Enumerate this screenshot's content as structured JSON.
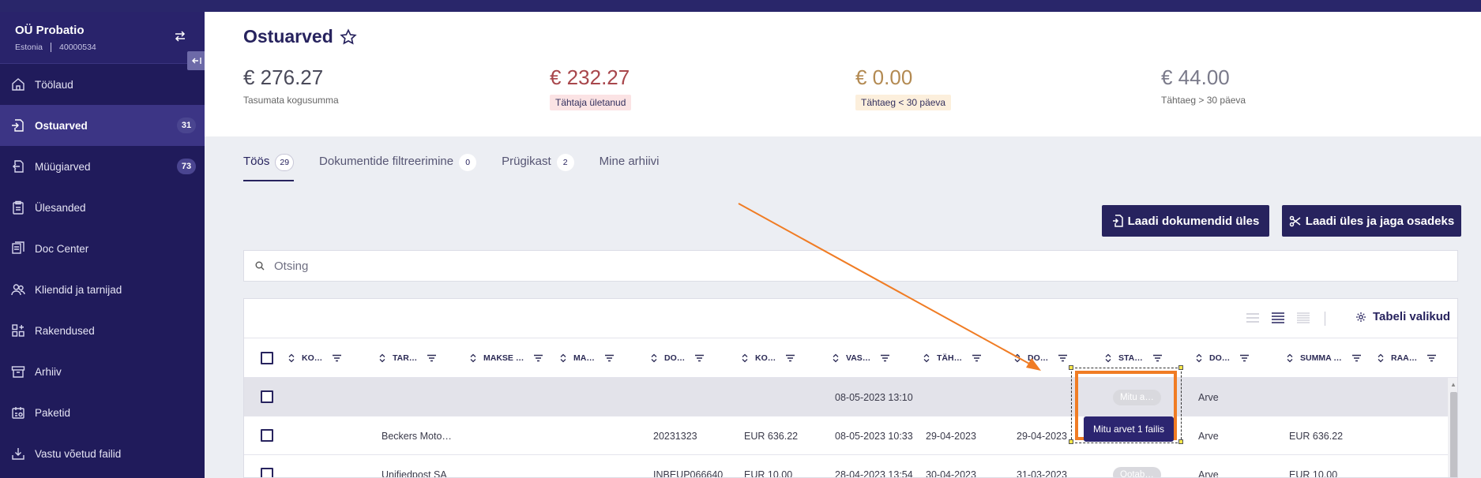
{
  "company": {
    "name": "OÜ Probatio",
    "country": "Estonia",
    "reg_code": "40000534"
  },
  "sidebar": {
    "items": [
      {
        "label": "Töölaud",
        "icon": "home-icon",
        "badge": ""
      },
      {
        "label": "Ostuarved",
        "icon": "inbox-in-icon",
        "badge": "31"
      },
      {
        "label": "Müügiarved",
        "icon": "outbox-icon",
        "badge": "73"
      },
      {
        "label": "Ülesanded",
        "icon": "clipboard-icon",
        "badge": ""
      },
      {
        "label": "Doc Center",
        "icon": "documents-icon",
        "badge": ""
      },
      {
        "label": "Kliendid ja tarnijad",
        "icon": "users-icon",
        "badge": ""
      },
      {
        "label": "Rakendused",
        "icon": "apps-icon",
        "badge": ""
      },
      {
        "label": "Arhiiv",
        "icon": "archive-icon",
        "badge": ""
      },
      {
        "label": "Paketid",
        "icon": "package-icon",
        "badge": ""
      },
      {
        "label": "Vastu võetud failid",
        "icon": "download-icon",
        "badge": ""
      }
    ]
  },
  "page": {
    "title": "Ostuarved",
    "stats": [
      {
        "amount": "€ 276.27",
        "label": "Tasumata kogusumma",
        "color": "#4a4a5a",
        "tag_bg": ""
      },
      {
        "amount": "€ 232.27",
        "label": "Tähtaja ületanud",
        "color": "#a8474c",
        "tag_bg": "#fbe3e4"
      },
      {
        "amount": "€ 0.00",
        "label": "Tähtaeg < 30 päeva",
        "color": "#b38a52",
        "tag_bg": "#fcefdc"
      },
      {
        "amount": "€ 44.00",
        "label": "Tähtaeg > 30 päeva",
        "color": "#7a7a8a",
        "tag_bg": ""
      }
    ]
  },
  "tabs": [
    {
      "label": "Töös",
      "badge": "29",
      "active": true
    },
    {
      "label": "Dokumentide filtreerimine",
      "badge": "0",
      "active": false
    },
    {
      "label": "Prügikast",
      "badge": "2",
      "active": false
    },
    {
      "label": "Mine arhiivi",
      "badge": "",
      "active": false
    }
  ],
  "actions": {
    "upload_label": "Laadi dokumendid üles",
    "upload_split_label": "Laadi üles ja jaga osadeks"
  },
  "search": {
    "placeholder": "Otsing",
    "value": ""
  },
  "table": {
    "options_label": "Tabeli valikud",
    "columns": [
      "KO…",
      "TAR…",
      "MAKSE …",
      "MA…",
      "DO…",
      "KO…",
      "VAS…",
      "TÄH…",
      "DO…",
      "STA…",
      "DO…",
      "SUMMA …",
      "RAA…"
    ],
    "rows": [
      [
        "",
        "",
        "",
        "",
        "",
        "",
        "08-05-2023 13:10",
        "",
        "",
        "Mitu a…",
        "Arve",
        "",
        ""
      ],
      [
        "",
        "Beckers Moto…",
        "",
        "",
        "20231323",
        "EUR 636.22",
        "08-05-2023 10:33",
        "29-04-2023",
        "29-04-2023",
        "",
        "Arve",
        "EUR 636.22",
        ""
      ],
      [
        "",
        "Unifiedpost SA",
        "",
        "",
        "INBEUP066640",
        "EUR 10.00",
        "28-04-2023 13:54",
        "30-04-2023",
        "31-03-2023",
        "Ootab…",
        "Arve",
        "EUR 10.00",
        ""
      ]
    ]
  },
  "tooltip": {
    "text": "Mitu arvet 1 failis"
  },
  "colors": {
    "sidebar_bg": "#201b5b",
    "accent": "#27235e",
    "annotation": "#f07c24"
  }
}
